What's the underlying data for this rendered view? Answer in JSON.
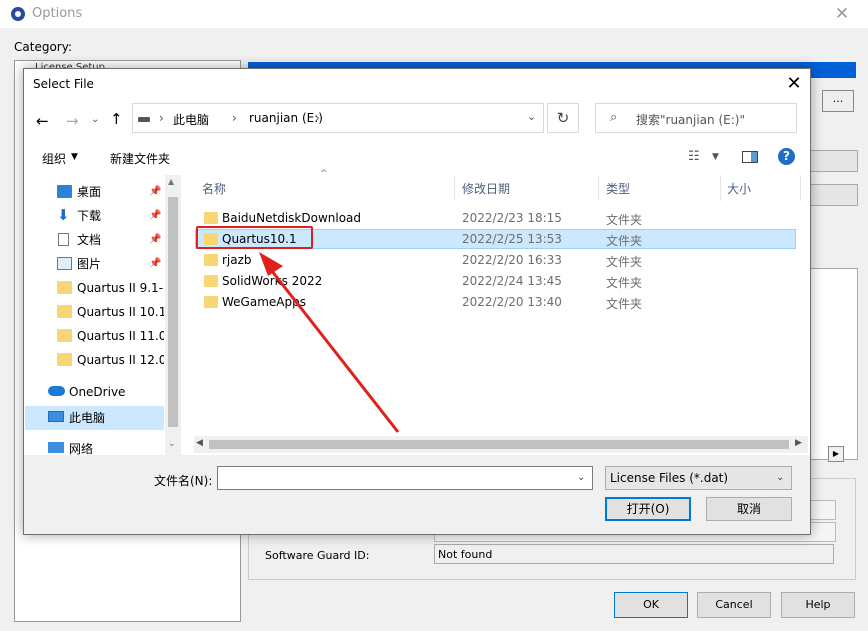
{
  "options_window": {
    "title": "Options",
    "close_glyph": "✕",
    "category_label": "Category:",
    "category_item": "License Setup",
    "browse_label": "...",
    "software_guard_label": "Software Guard ID:",
    "software_guard_value": "Not found",
    "ok_label": "OK",
    "cancel_label": "Cancel",
    "help_label": "Help"
  },
  "dialog": {
    "title": "Select File",
    "close_glyph": "✕",
    "nav": {
      "back": "←",
      "forward": "→",
      "recent": "⌄",
      "up": "↑"
    },
    "address": {
      "crumbs": [
        "此电脑",
        "ruanjian (E:)"
      ],
      "separator": "›",
      "dropdown": "⌄",
      "refresh": "↻"
    },
    "search": {
      "placeholder": "搜索\"ruanjian (E:)\"",
      "icon": "search-icon"
    },
    "toolbar": {
      "organize": "组织",
      "organize_caret": "▼",
      "new_folder": "新建文件夹",
      "view_caret": "▼",
      "help": "?"
    },
    "nav_pane": {
      "items": [
        {
          "label": "桌面",
          "icon": "desktop-icon",
          "pinned": true
        },
        {
          "label": "下载",
          "icon": "download-icon",
          "pinned": true
        },
        {
          "label": "文档",
          "icon": "document-icon",
          "pinned": true
        },
        {
          "label": "图片",
          "icon": "picture-icon",
          "pinned": true
        },
        {
          "label": "Quartus II 9.1-(",
          "icon": "folder-icon",
          "pinned": false
        },
        {
          "label": "Quartus II 10.1",
          "icon": "folder-icon",
          "pinned": false
        },
        {
          "label": "Quartus II 11.0",
          "icon": "folder-icon",
          "pinned": false
        },
        {
          "label": "Quartus II 12.0",
          "icon": "folder-icon",
          "pinned": false
        },
        {
          "label": "OneDrive",
          "icon": "cloud-icon",
          "pinned": false
        },
        {
          "label": "此电脑",
          "icon": "computer-icon",
          "pinned": false,
          "selected": true
        },
        {
          "label": "网络",
          "icon": "network-icon",
          "pinned": false
        }
      ]
    },
    "columns": {
      "name": "名称",
      "modified": "修改日期",
      "type": "类型",
      "size": "大小"
    },
    "files": [
      {
        "name": "BaiduNetdiskDownload",
        "modified": "2022/2/23 18:15",
        "type": "文件夹"
      },
      {
        "name": "Quartus10.1",
        "modified": "2022/2/25 13:53",
        "type": "文件夹",
        "selected": true
      },
      {
        "name": "rjazb",
        "modified": "2022/2/20 16:33",
        "type": "文件夹"
      },
      {
        "name": "SolidWorks 2022",
        "modified": "2022/2/24 13:45",
        "type": "文件夹"
      },
      {
        "name": "WeGameApps",
        "modified": "2022/2/20 13:40",
        "type": "文件夹"
      }
    ],
    "filename_label": "文件名(N):",
    "filename_value": "",
    "filetype_value": "License Files (*.dat)",
    "open_label": "打开(O)",
    "cancel_label": "取消"
  },
  "colors": {
    "selection": "#cce8ff",
    "accent": "#0078d7",
    "annotation_red": "#e0201b",
    "folder": "#f7d674"
  }
}
